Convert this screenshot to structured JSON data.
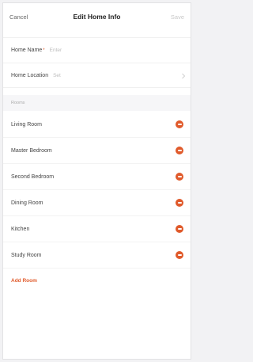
{
  "navbar": {
    "cancel_label": "Cancel",
    "title": "Edit Home Info",
    "save_label": "Save"
  },
  "form": {
    "home_name_label": "Home Name",
    "home_name_required_mark": "*",
    "home_name_placeholder": "Enter",
    "home_location_label": "Home Location",
    "home_location_value": "Set"
  },
  "rooms_section": {
    "header": "Rooms",
    "items": [
      {
        "label": "Living Room"
      },
      {
        "label": "Master Bedroom"
      },
      {
        "label": "Second Bedroom"
      },
      {
        "label": "Dining Room"
      },
      {
        "label": "Kitchen"
      },
      {
        "label": "Study Room"
      }
    ],
    "add_label": "Add Room"
  },
  "colors": {
    "accent": "#e05a2b",
    "placeholder": "#bdbdbd"
  },
  "icons": {
    "remove": "minus-circle-icon",
    "chevron": "chevron-right-icon"
  }
}
